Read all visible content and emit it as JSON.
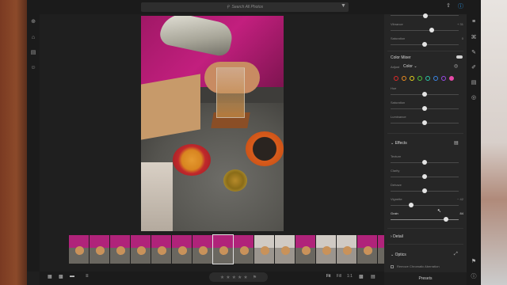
{
  "app": {
    "search_placeholder": "Search All Photos"
  },
  "topbar": {
    "icons": [
      "filter-icon",
      "share-icon",
      "help-icon",
      "cloud-icon"
    ]
  },
  "leftrail": {
    "icons": [
      "add-icon",
      "home-icon",
      "library-icon",
      "people-icon"
    ]
  },
  "panel": {
    "sliders_top": [
      {
        "label": "Vibrance",
        "value": "+ 31",
        "pos": 0.6
      },
      {
        "label": "Saturation",
        "value": "0",
        "pos": 0.5
      }
    ],
    "color_mixer": {
      "title": "Color Mixer",
      "adjust_label": "Adjust",
      "adjust_value": "Color",
      "colors": [
        "#e02a2a",
        "#e88a20",
        "#e6d21e",
        "#4fc23a",
        "#2ac4a8",
        "#3a86e6",
        "#9a4ae6",
        "#e64aa8"
      ],
      "sliders": [
        {
          "label": "Hue",
          "value": "0",
          "pos": 0.5
        },
        {
          "label": "Saturation",
          "value": "0",
          "pos": 0.5
        },
        {
          "label": "Luminance",
          "value": "0",
          "pos": 0.5
        }
      ]
    },
    "effects": {
      "title": "Effects",
      "sliders": [
        {
          "label": "Texture",
          "value": "0",
          "pos": 0.5
        },
        {
          "label": "Clarity",
          "value": "0",
          "pos": 0.5
        },
        {
          "label": "Dehaze",
          "value": "0",
          "pos": 0.5
        },
        {
          "label": "Vignette",
          "value": "− 42",
          "pos": 0.3
        },
        {
          "label": "Grain",
          "value": "84",
          "pos": 0.9
        }
      ]
    },
    "detail_title": "Detail",
    "optics": {
      "title": "Optics",
      "remove_ca": "Remove Chromatic Aberration"
    },
    "presets_label": "Presets"
  },
  "bottombar": {
    "rating": [
      "★",
      "★",
      "★",
      "★",
      "★"
    ],
    "zoom": {
      "fit": "Fit",
      "fill": "Fill",
      "one_to_one": "1:1"
    }
  },
  "filmstrip": {
    "thumb_count": 16,
    "selected_index": 7
  }
}
